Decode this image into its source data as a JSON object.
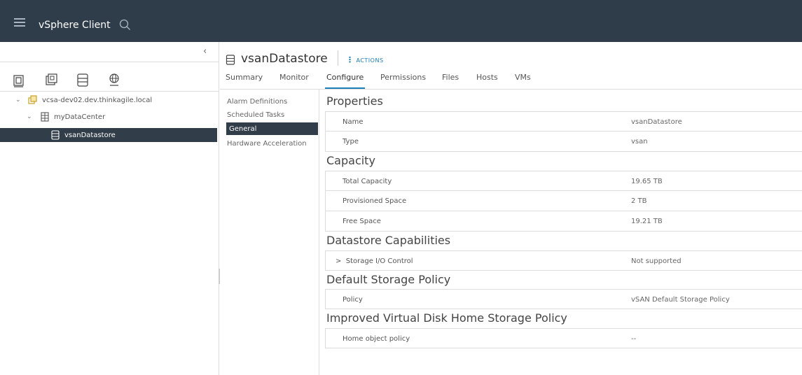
{
  "header": {
    "app_title": "vSphere Client"
  },
  "nav": {
    "collapse_glyph": "‹",
    "icons": [
      "hosts-clusters-icon",
      "vms-templates-icon",
      "storage-icon",
      "networking-icon"
    ],
    "tree": [
      {
        "label": "vcsa-dev02.dev.thinkagile.local",
        "expanded": true
      },
      {
        "label": "myDataCenter",
        "expanded": true
      },
      {
        "label": "vsanDatastore",
        "selected": true
      }
    ]
  },
  "object": {
    "title": "vsanDatastore",
    "actions_label": "ACTIONS"
  },
  "tabs": [
    "Summary",
    "Monitor",
    "Configure",
    "Permissions",
    "Files",
    "Hosts",
    "VMs"
  ],
  "active_tab": "Configure",
  "subnav": [
    "Alarm Definitions",
    "Scheduled Tasks",
    "General",
    "Hardware Acceleration"
  ],
  "active_subnav": "General",
  "sections": {
    "properties": {
      "title": "Properties",
      "rows": [
        {
          "key": "Name",
          "value": "vsanDatastore"
        },
        {
          "key": "Type",
          "value": "vsan"
        }
      ]
    },
    "capacity": {
      "title": "Capacity",
      "rows": [
        {
          "key": "Total Capacity",
          "value": "19.65 TB"
        },
        {
          "key": "Provisioned Space",
          "value": "2 TB"
        },
        {
          "key": "Free Space",
          "value": "19.21 TB"
        }
      ]
    },
    "capabilities": {
      "title": "Datastore Capabilities",
      "rows": [
        {
          "key": "Storage I/O Control",
          "value": "Not supported",
          "expand_glyph": ">"
        }
      ]
    },
    "default_policy": {
      "title": "Default Storage Policy",
      "rows": [
        {
          "key": "Policy",
          "value": "vSAN Default Storage Policy"
        }
      ]
    },
    "vdisk_policy": {
      "title": "Improved Virtual Disk Home Storage Policy",
      "rows": [
        {
          "key": "Home object policy",
          "value": "--"
        }
      ]
    }
  },
  "colors": {
    "header_bg": "#2f3d4a",
    "accent": "#1c7fb5",
    "selected_bg": "#313d48"
  }
}
